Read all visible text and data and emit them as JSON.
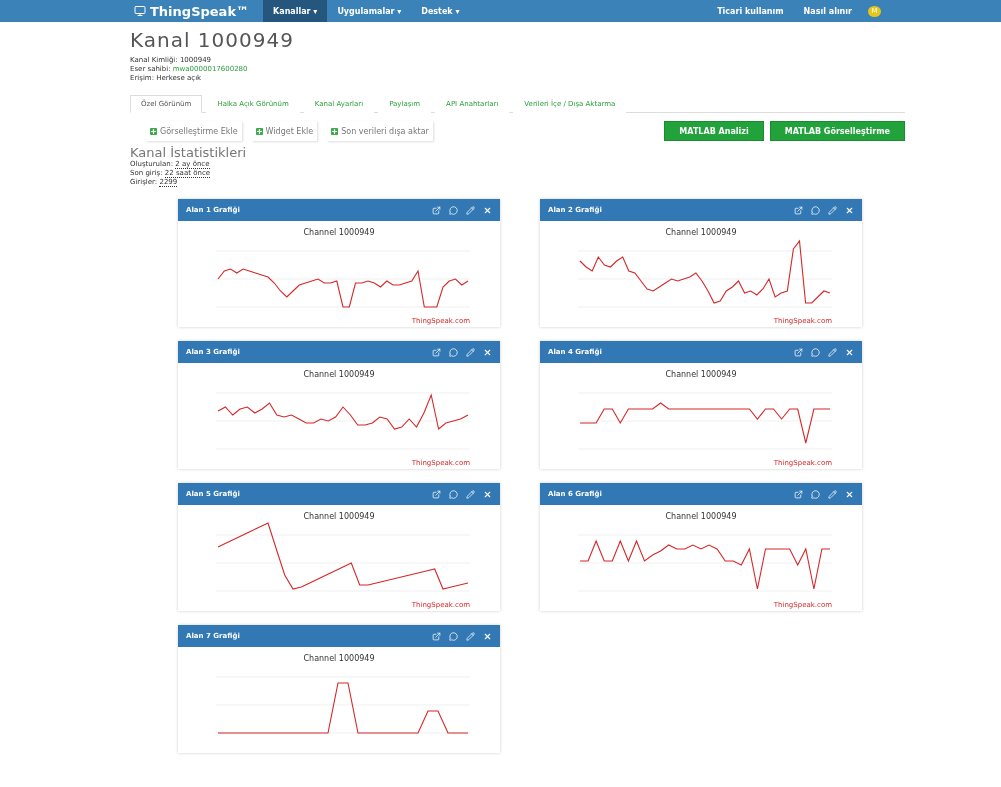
{
  "navbar": {
    "logo": "ThingSpeak™",
    "menus": [
      {
        "label": "Kanallar ▾",
        "selected": true
      },
      {
        "label": "Uygulamalar ▾",
        "selected": false
      },
      {
        "label": "Destek ▾",
        "selected": false
      }
    ],
    "links": [
      "Ticari kullanım",
      "Nasıl alınır"
    ],
    "avatar": "M"
  },
  "channel": {
    "title": "Kanal 1000949",
    "info": [
      {
        "label": "Kanal Kimliği:",
        "value": "1000949",
        "kind": "plain"
      },
      {
        "label": "Eser sahibi:",
        "value": "mwa0000017600280",
        "kind": "link"
      },
      {
        "label": "Erişim:",
        "value": "Herkese açık",
        "kind": "plain"
      }
    ]
  },
  "tabs": [
    {
      "label": "Özel Görünüm",
      "selected": true
    },
    {
      "label": "Halka Açık Görünüm",
      "selected": false
    },
    {
      "label": "Kanal Ayarları",
      "selected": false
    },
    {
      "label": "Paylaşım",
      "selected": false
    },
    {
      "label": "API Anahtarları",
      "selected": false
    },
    {
      "label": "Verileri İçe / Dışa Aktarma",
      "selected": false
    }
  ],
  "actions": [
    "Görselleştirme Ekle",
    "Widget Ekle",
    "Son verileri dışa aktar"
  ],
  "matlab_buttons": [
    "MATLAB Analizi",
    "MATLAB Görselleştirme"
  ],
  "stats": {
    "title": "Kanal İstatistikleri",
    "items": [
      {
        "label": "Oluşturulan:",
        "value": "2 ay önce"
      },
      {
        "label": "Son giriş:",
        "value": "22 saat önce"
      },
      {
        "label": "Girişler:",
        "value": "2299"
      }
    ]
  },
  "panels": [
    {
      "title": "Alan 1 Grafiği",
      "chart_title": "Channel 1000949",
      "credit": "ThingSpeak.com"
    },
    {
      "title": "Alan 2 Grafiği",
      "chart_title": "Channel 1000949",
      "credit": "ThingSpeak.com"
    },
    {
      "title": "Alan 3 Grafiği",
      "chart_title": "Channel 1000949",
      "credit": "ThingSpeak.com"
    },
    {
      "title": "Alan 4 Grafiği",
      "chart_title": "Channel 1000949",
      "credit": "ThingSpeak.com"
    },
    {
      "title": "Alan 5 Grafiği",
      "chart_title": "Channel 1000949",
      "credit": "ThingSpeak.com"
    },
    {
      "title": "Alan 6 Grafiği",
      "chart_title": "Channel 1000949",
      "credit": "ThingSpeak.com"
    },
    {
      "title": "Alan 7 Grafiği",
      "chart_title": "Channel 1000949"
    }
  ]
}
